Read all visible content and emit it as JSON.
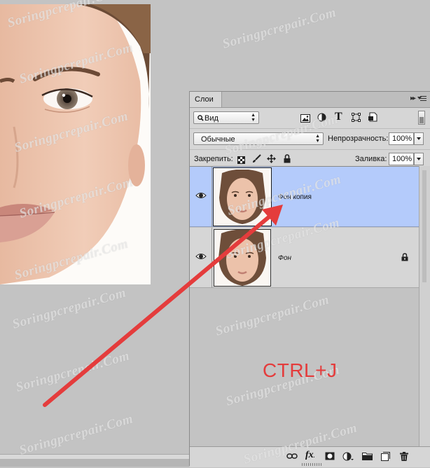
{
  "watermarks": [
    "Soringpcrepair.Com",
    "Soringpcrepair.Com",
    "Soringpcrepair.Com",
    "Soringpcrepair.Com",
    "Soringpcrepair.Com",
    "Soringpcrepair.Com",
    "Soringpcrepair.Com",
    "Soringpcrepair.Com",
    "Soringpcrepair.Com",
    "Soringpcrepair.Com",
    "Soringpcrepair.Com",
    "Soringpcrepair.Com",
    "Soringpcrepair.Com",
    "Soringpcrepair.Com",
    "Soringpcrepair.Com"
  ],
  "panel": {
    "tab_label": "Слои",
    "collapse_glyph": "▸▸",
    "filter": {
      "label": "Вид"
    },
    "blend_mode": {
      "value": "Обычные"
    },
    "opacity": {
      "label": "Непрозрачность:",
      "value": "100%"
    },
    "lock": {
      "label": "Закрепить:"
    },
    "fill": {
      "label": "Заливка:",
      "value": "100%"
    },
    "layers": [
      {
        "name": "Фон копия",
        "selected": true,
        "visible": true
      },
      {
        "name": "Фон",
        "selected": false,
        "visible": true,
        "locked": true
      }
    ]
  },
  "annotation": {
    "shortcut": "CTRL+J",
    "color": "#e43c3c"
  },
  "colors": {
    "selected_layer": "#b4cbfb",
    "panel_bg": "#d6d6d6",
    "workspace": "#c3c3c3"
  }
}
